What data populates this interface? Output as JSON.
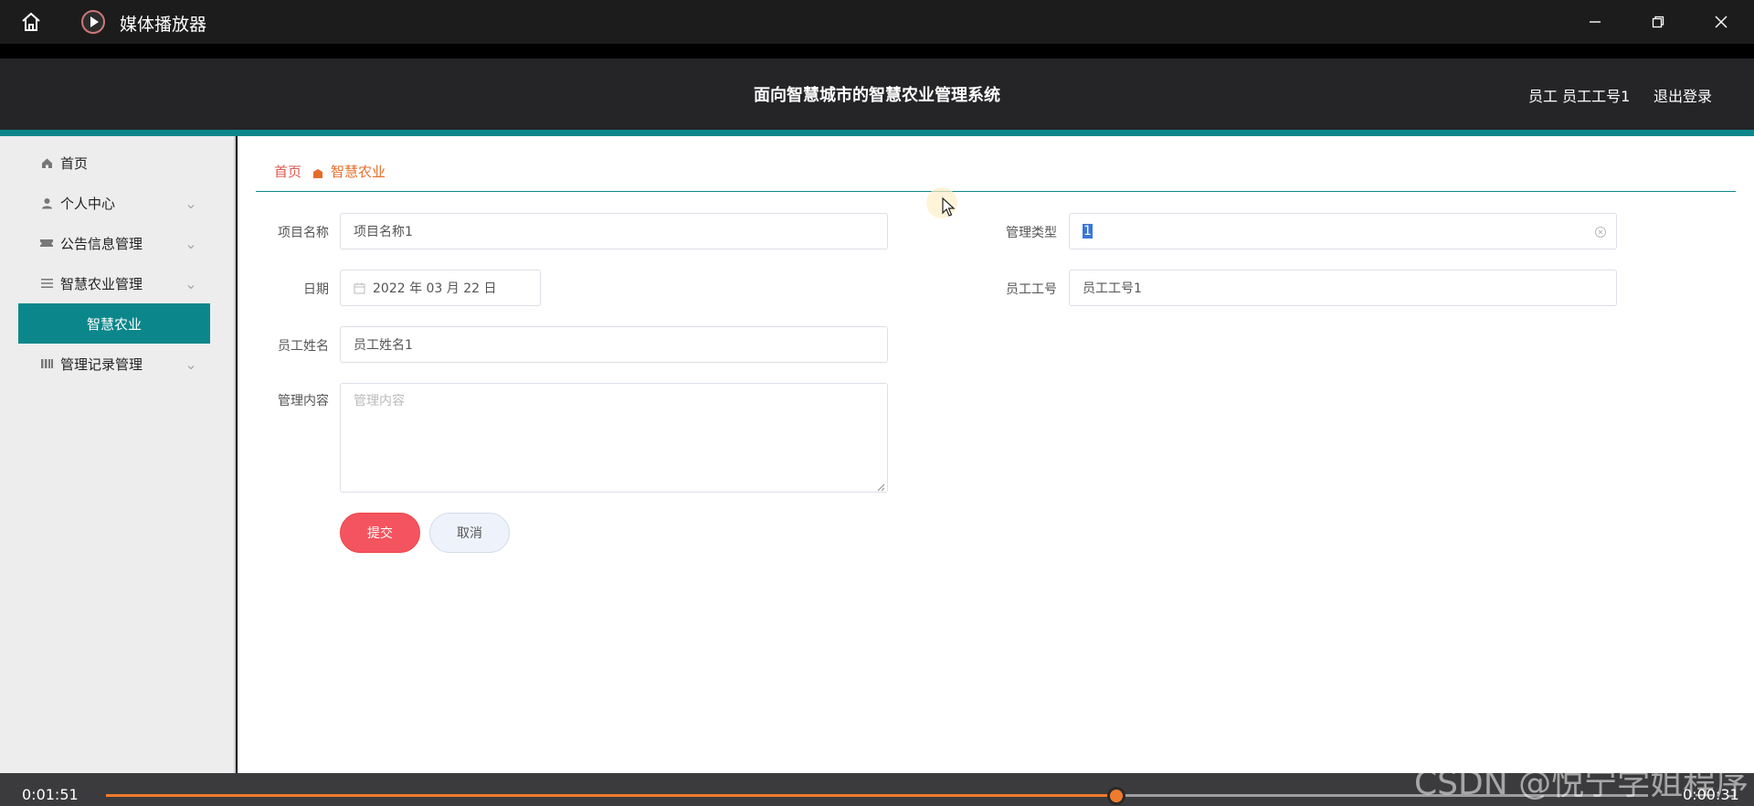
{
  "window": {
    "title": "媒体播放器",
    "icons": {
      "home": "home-icon",
      "app": "play-icon",
      "minimize": "minimize-icon",
      "maximize": "restore-icon",
      "close": "close-icon"
    }
  },
  "header": {
    "title": "面向智慧城市的智慧农业管理系统",
    "user_label": "员工  员工工号1",
    "logout_label": "退出登录"
  },
  "sidebar": {
    "items": [
      {
        "label": "首页",
        "icon": "home-icon"
      },
      {
        "label": "个人中心",
        "icon": "user-icon"
      },
      {
        "label": "公告信息管理",
        "icon": "ticket-icon"
      },
      {
        "label": "智慧农业管理",
        "icon": "list-icon"
      },
      {
        "label": "管理记录管理",
        "icon": "bars-icon"
      }
    ],
    "active_sub": "智慧农业"
  },
  "breadcrumb": {
    "home": "首页",
    "current": "智慧农业"
  },
  "form": {
    "project_name": {
      "label": "项目名称",
      "value": "项目名称1"
    },
    "manage_type": {
      "label": "管理类型",
      "value": "1"
    },
    "date": {
      "label": "日期",
      "value": "2022 年 03 月 22 日"
    },
    "employee_no": {
      "label": "员工工号",
      "value": "员工工号1"
    },
    "employee_name": {
      "label": "员工姓名",
      "value": "员工姓名1"
    },
    "content": {
      "label": "管理内容",
      "placeholder": "管理内容"
    },
    "submit_label": "提交",
    "cancel_label": "取消"
  },
  "player": {
    "elapsed": "0:01:51",
    "remaining": "0:00:31",
    "progress_fraction": 0.655,
    "accent": "#f07b2c"
  },
  "watermark": "CSDN @悦宁学姐程序",
  "colors": {
    "teal": "#0b878b",
    "submit": "#f4545f",
    "breadcrumb_home": "#e0564f",
    "breadcrumb_current": "#e46d2a"
  }
}
